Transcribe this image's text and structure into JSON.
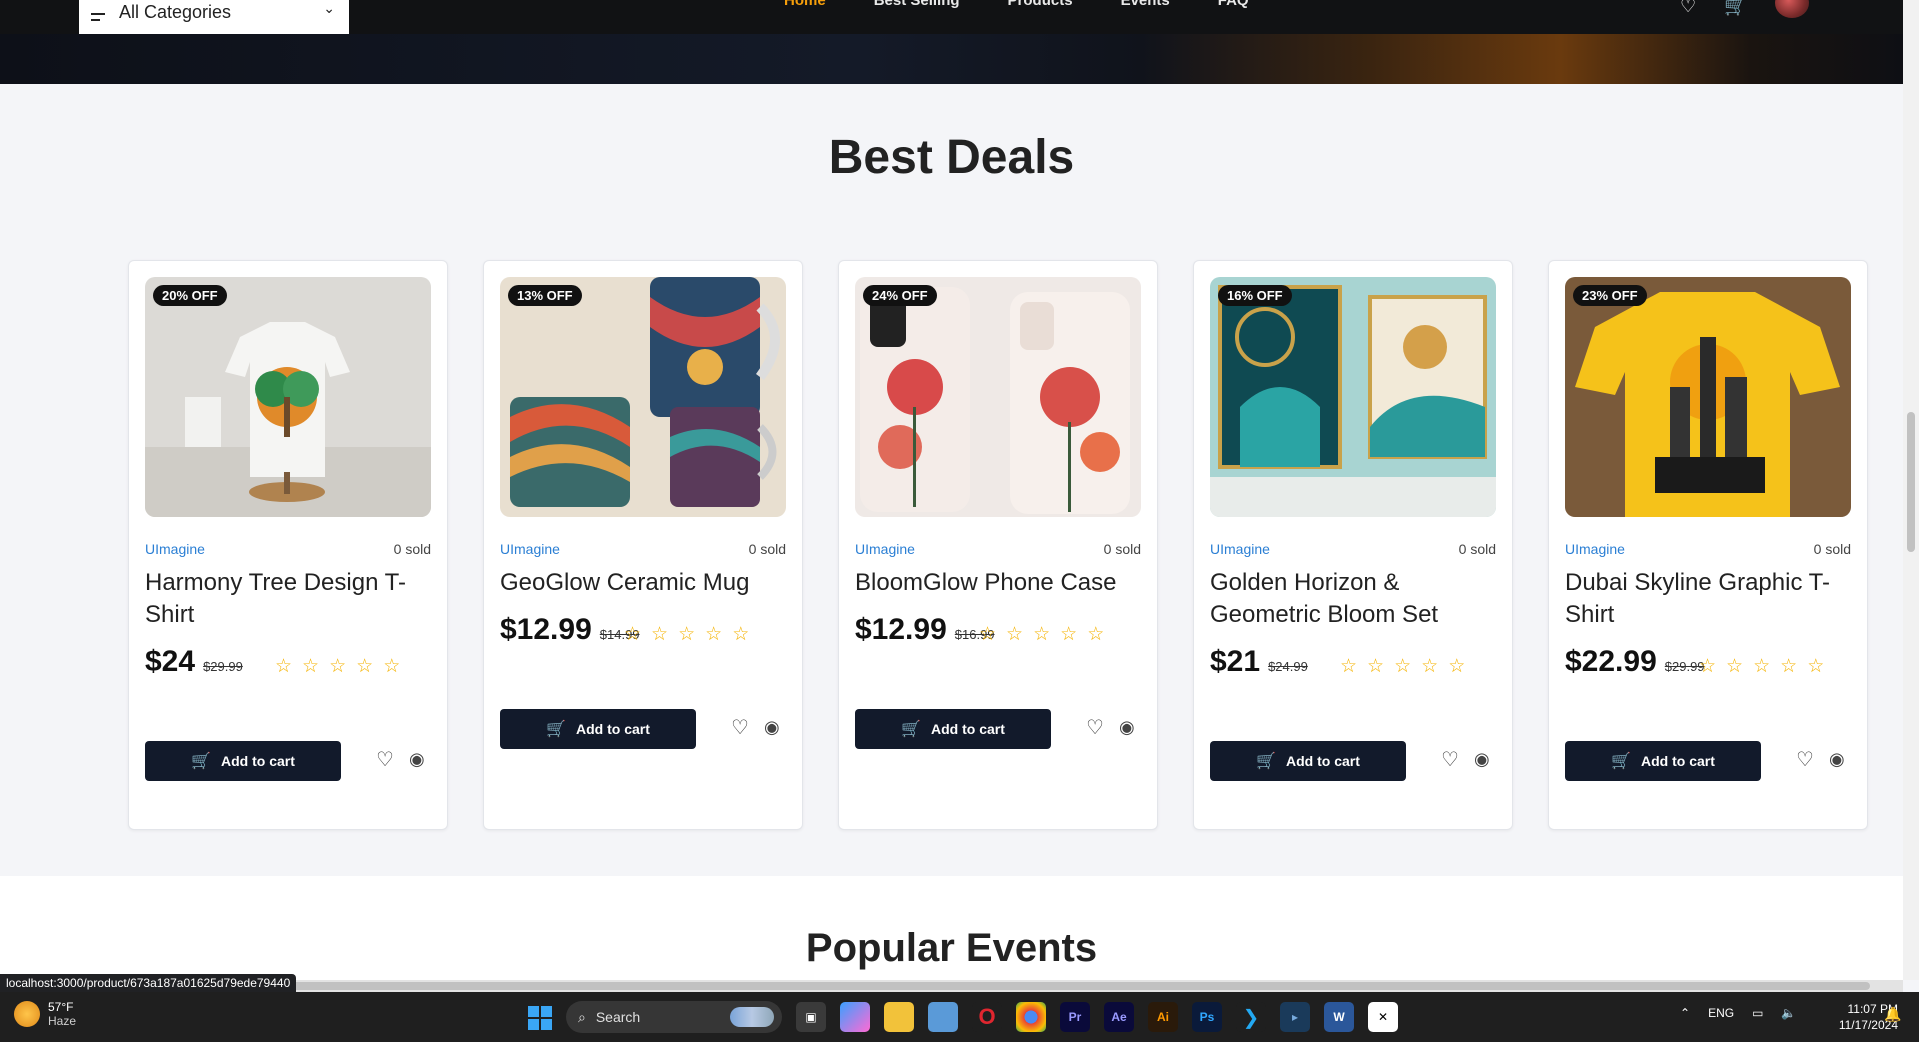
{
  "nav": {
    "category_label": "All Categories",
    "links": [
      "Home",
      "Best Selling",
      "Products",
      "Events",
      "FAQ"
    ],
    "active_index": 0,
    "accent_color": "#f59e0b"
  },
  "section": {
    "title": "Best Deals"
  },
  "products": [
    {
      "badge": "20% OFF",
      "shop": "UImagine",
      "sold": "0 sold",
      "name": "Harmony Tree Design T-Shirt",
      "price": "$24",
      "old_price": "$29.99",
      "rating": 0,
      "cart_label": "Add to cart"
    },
    {
      "badge": "13% OFF",
      "shop": "UImagine",
      "sold": "0 sold",
      "name": "GeoGlow Ceramic Mug",
      "price": "$12.99",
      "old_price": "$14.99",
      "rating": 0,
      "cart_label": "Add to cart"
    },
    {
      "badge": "24% OFF",
      "shop": "UImagine",
      "sold": "0 sold",
      "name": "BloomGlow Phone Case",
      "price": "$12.99",
      "old_price": "$16.99",
      "rating": 0,
      "cart_label": "Add to cart"
    },
    {
      "badge": "16% OFF",
      "shop": "UImagine",
      "sold": "0 sold",
      "name": "Golden Horizon & Geometric Bloom Set",
      "price": "$21",
      "old_price": "$24.99",
      "rating": 0,
      "cart_label": "Add to cart"
    },
    {
      "badge": "23% OFF",
      "shop": "UImagine",
      "sold": "0 sold",
      "name": "Dubai Skyline Graphic T-Shirt",
      "price": "$22.99",
      "old_price": "$29.99",
      "rating": 0,
      "cart_label": "Add to cart"
    }
  ],
  "popular": {
    "title": "Popular Events"
  },
  "status_url": "localhost:3000/product/673a187a01625d79ede79440",
  "taskbar": {
    "weather_temp": "57°F",
    "weather_desc": "Haze",
    "search_placeholder": "Search",
    "lang": "ENG",
    "time": "11:07 PM",
    "date": "11/17/2024",
    "apps": [
      "task-view",
      "copilot",
      "file-explorer",
      "photos",
      "opera",
      "chrome",
      "premiere-pro",
      "after-effects",
      "illustrator",
      "photoshop",
      "vscode",
      "terminal",
      "word",
      "capcut"
    ]
  }
}
